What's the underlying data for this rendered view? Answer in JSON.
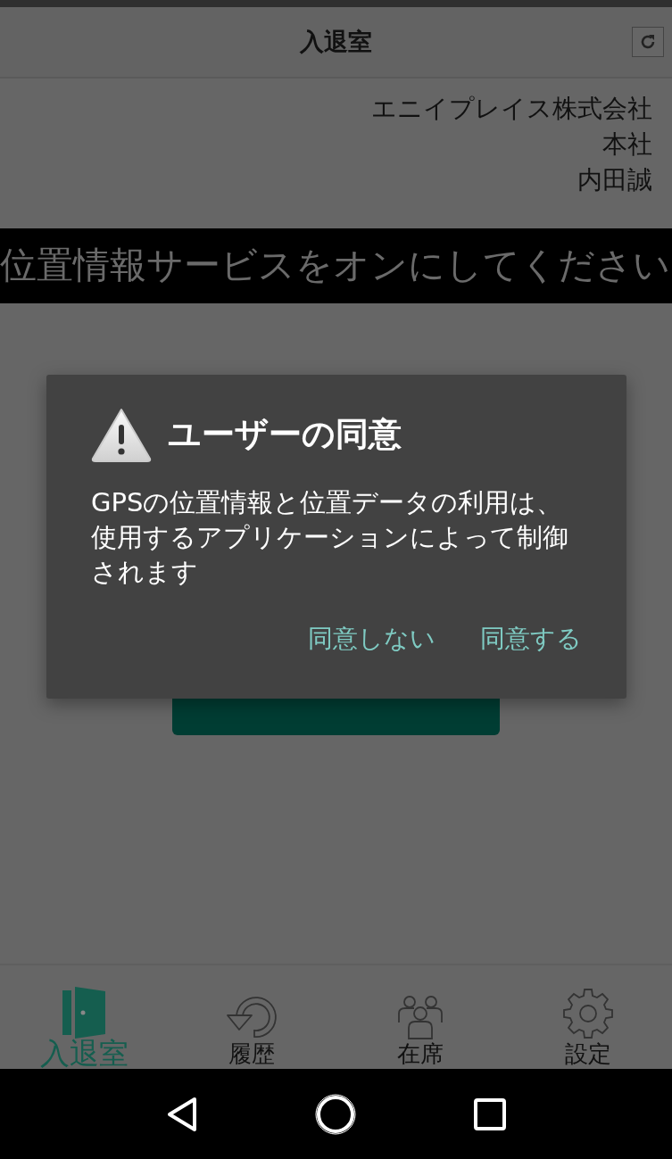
{
  "header": {
    "title": "入退室"
  },
  "account": {
    "lines": [
      "エニイプレイス株式会社",
      "本社",
      "内田誠"
    ]
  },
  "banner": {
    "text": "位置情報サービスをオンにしてください"
  },
  "dialog": {
    "title": "ユーザーの同意",
    "message": "GPSの位置情報と位置データの利用は、使用するアプリケーションによって制御されます",
    "buttons": [
      {
        "label": "同意しない"
      },
      {
        "label": "同意する"
      }
    ]
  },
  "tabs": [
    {
      "label": "入退室",
      "kind": "door",
      "selected": true
    },
    {
      "label": "履歴",
      "kind": "history",
      "selected": false
    },
    {
      "label": "在席",
      "kind": "people",
      "selected": false
    },
    {
      "label": "設定",
      "kind": "gear",
      "selected": false
    }
  ]
}
